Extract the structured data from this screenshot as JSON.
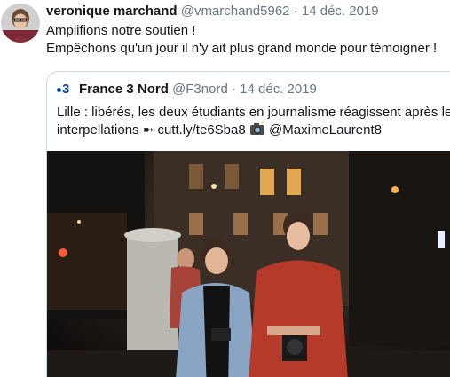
{
  "tweet": {
    "author_name": "veronique marchand",
    "handle": "@vmarchand5962",
    "separator": "·",
    "date": "14 déc. 2019",
    "lines": [
      "Amplifions notre soutien !",
      "Empêchons qu'un jour il n'y ait plus grand monde pour témoigner !"
    ]
  },
  "quoted_tweet": {
    "logo_text": "3",
    "author_name": "France 3 Nord",
    "handle": "@F3nord",
    "separator": "·",
    "date": "14 déc. 2019",
    "line1": "Lille : libérés, les deux étudiants en journalisme réagissent après leurs",
    "line2_prefix": "interpellations ➼ cutt.ly/te6Sba8",
    "line2_suffix": "@MaximeLaurent8",
    "camera_icon": "camera-with-flash-icon"
  },
  "colors": {
    "text_primary": "#14171a",
    "text_secondary": "#657786",
    "border": "#ccd6dd",
    "logo_blue": "#0a4a9a"
  }
}
